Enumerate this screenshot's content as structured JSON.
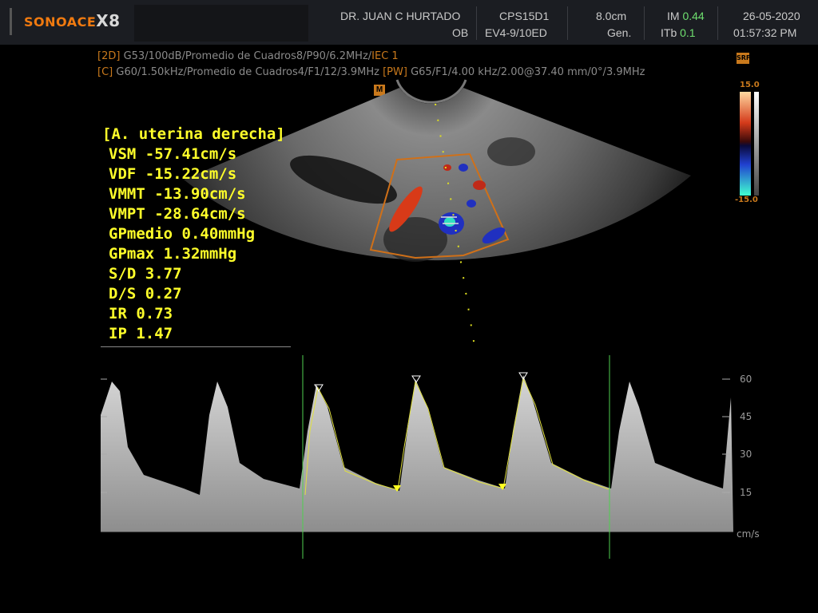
{
  "header": {
    "logo_brand": "SONOACE",
    "logo_model": "X8",
    "doctor": "DR. JUAN C HURTADO",
    "exam": "OB",
    "probe": "CPS15D1",
    "preset": "EV4-9/10ED",
    "depth": "8.0cm",
    "mode": "Gen.",
    "im_label": "IM",
    "im_value": "0.44",
    "itb_label": "ITb",
    "itb_value": "0.1",
    "date": "26-05-2020",
    "time": "01:57:32 PM"
  },
  "params": {
    "twod_tag": "[2D]",
    "twod_text": "G53/100dB/Promedio de Cuadros8/P90/6.2MHz/",
    "twod_iec": "IEC 1",
    "c_tag": "[C]",
    "c_text": "G60/1.50kHz/Promedio de Cuadros4/F1/12/3.9MHz",
    "pw_tag": "[PW]",
    "pw_text": "G65/F1/4.00 kHz/2.00@37.40 mm/0°/3.9MHz"
  },
  "measurements": {
    "title": "[A. uterina derecha]",
    "rows": [
      "VSM -57.41cm/s",
      "VDF -15.22cm/s",
      "VMMT -13.90cm/s",
      "VMPT -28.64cm/s",
      "GPmedio 0.40mmHg",
      "GPmax 1.32mmHg",
      "S/D 3.77",
      "D/S 0.27",
      "IR  0.73",
      "IP  1.47"
    ]
  },
  "colorbar": {
    "top": "15.0",
    "bottom": "-15.0"
  },
  "icons": {
    "srf": "SRF",
    "marker": "M"
  },
  "doppler": {
    "unit": "cm/s",
    "ticks": [
      "60",
      "45",
      "30",
      "15"
    ]
  },
  "colors": {
    "accent_yellow": "#ffff2a",
    "accent_orange": "#c9791c",
    "gain_green": "#6fe06f"
  }
}
